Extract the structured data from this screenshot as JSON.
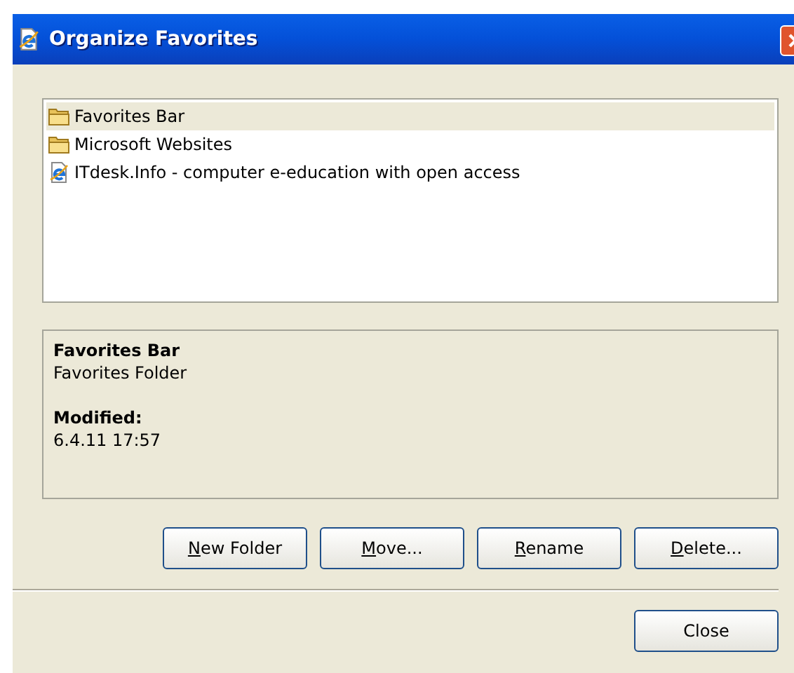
{
  "window": {
    "title": "Organize Favorites"
  },
  "favorites": [
    {
      "kind": "folder",
      "name": "Favorites Bar",
      "selected": true
    },
    {
      "kind": "folder",
      "name": "Microsoft Websites",
      "selected": false
    },
    {
      "kind": "link",
      "name": "ITdesk.Info - computer e-education with open access",
      "selected": false
    }
  ],
  "details": {
    "name": "Favorites Bar",
    "type": "Favorites Folder",
    "modified_label": "Modified:",
    "modified": "6.4.11 17:57"
  },
  "action_buttons": [
    {
      "label": "New Folder",
      "underline_first": true
    },
    {
      "label": "Move...",
      "underline_first": true
    },
    {
      "label": "Rename",
      "underline_first": true
    },
    {
      "label": "Delete...",
      "underline_first": true
    }
  ],
  "close_button": {
    "label": "Close",
    "underline_first": false
  }
}
